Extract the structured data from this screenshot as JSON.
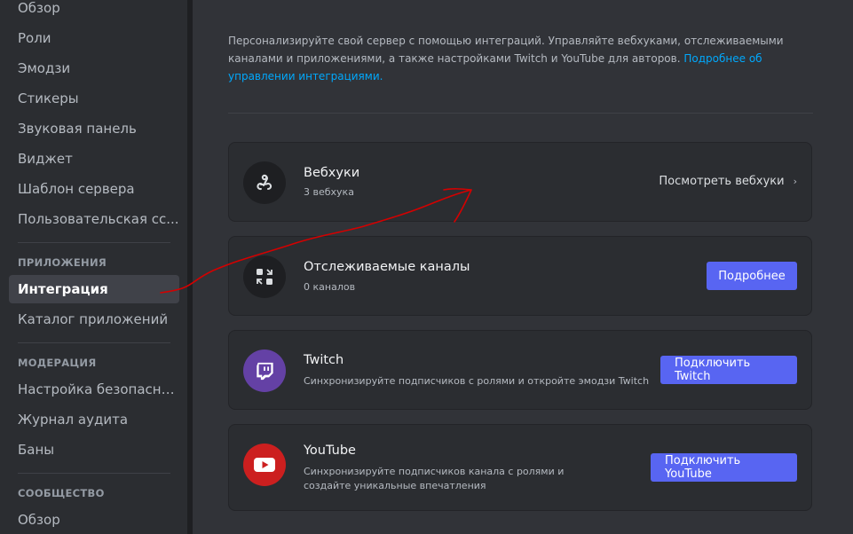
{
  "sidebar": {
    "items_top": [
      "Обзор",
      "Роли",
      "Эмодзи",
      "Стикеры",
      "Звуковая панель",
      "Виджет",
      "Шаблон сервера",
      "Пользовательская сс..."
    ],
    "section_apps": "ПРИЛОЖЕНИЯ",
    "apps_items": [
      "Интеграция",
      "Каталог приложений"
    ],
    "section_moderation": "МОДЕРАЦИЯ",
    "moderation_items": [
      "Настройка безопасно...",
      "Журнал аудита",
      "Баны"
    ],
    "section_community": "СООБЩЕСТВО",
    "community_items": [
      "Обзор"
    ]
  },
  "intro": {
    "text": "Персонализируйте свой сервер с помощью интеграций. Управляйте вебхуками, отслеживаемыми каналами и приложениями, а также настройками Twitch и YouTube для авторов.",
    "link": "Подробнее об управлении интеграциями."
  },
  "cards": {
    "webhooks": {
      "title": "Вебхуки",
      "sub": "3 вебхука",
      "action": "Посмотреть вебхуки",
      "icon": "webhook-icon"
    },
    "followed": {
      "title": "Отслеживаемые каналы",
      "sub": "0 каналов",
      "action": "Подробнее",
      "icon": "followed-channels-icon"
    },
    "twitch": {
      "title": "Twitch",
      "sub": "Синхронизируйте подписчиков с ролями и откройте эмодзи Twitch",
      "action": "Подключить Twitch",
      "icon": "twitch-icon",
      "color": "#6441a5"
    },
    "youtube": {
      "title": "YouTube",
      "sub": "Синхронизируйте подписчиков канала с ролями и создайте уникальные впечатления",
      "action": "Подключить YouTube",
      "icon": "youtube-icon",
      "color": "#cc1f1f"
    }
  },
  "colors": {
    "accent": "#5865f2",
    "annotation": "#d40000"
  }
}
